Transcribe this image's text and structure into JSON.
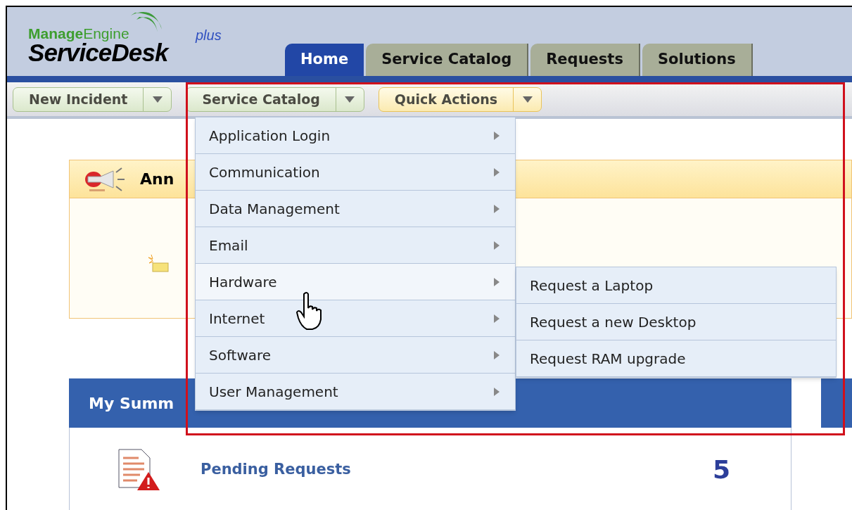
{
  "logo": {
    "brand": "**Manage**Engine",
    "product": "ServiceDesk",
    "edition": "plus"
  },
  "tabs": [
    {
      "label": "Home",
      "selected": true
    },
    {
      "label": "Service Catalog",
      "selected": false
    },
    {
      "label": "Requests",
      "selected": false
    },
    {
      "label": "Solutions",
      "selected": false
    }
  ],
  "toolbar": [
    {
      "label": "New Incident",
      "kind": "green"
    },
    {
      "label": "Service Catalog",
      "kind": "green"
    },
    {
      "label": "Quick Actions",
      "kind": "yellow"
    }
  ],
  "announcements": {
    "title": "Ann"
  },
  "summary": {
    "title": "My Summ",
    "rows": [
      {
        "label": "Pending Requests",
        "count": "5"
      }
    ]
  },
  "service_catalog_menu": [
    {
      "label": "Application Login",
      "selected": false
    },
    {
      "label": "Communication",
      "selected": false
    },
    {
      "label": "Data Management",
      "selected": false
    },
    {
      "label": "Email",
      "selected": false
    },
    {
      "label": "Hardware",
      "selected": true,
      "children": [
        {
          "label": "Request a Laptop"
        },
        {
          "label": "Request a new Desktop"
        },
        {
          "label": "Request RAM upgrade"
        }
      ]
    },
    {
      "label": "Internet",
      "selected": false
    },
    {
      "label": "Software",
      "selected": false
    },
    {
      "label": "User Management",
      "selected": false
    }
  ]
}
